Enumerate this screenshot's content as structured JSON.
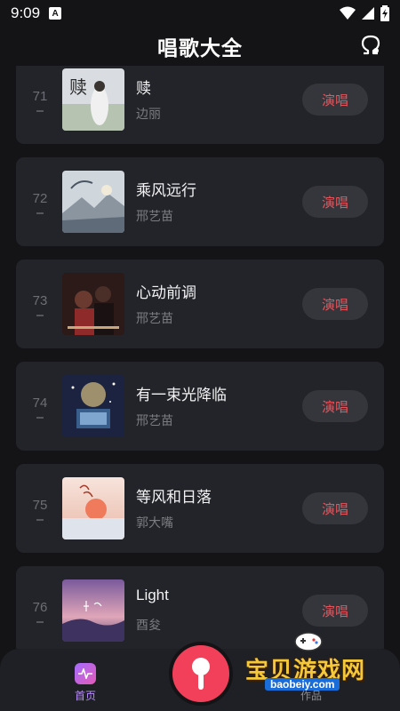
{
  "status_bar": {
    "time": "9:09",
    "badge": "A"
  },
  "header": {
    "title": "唱歌大全",
    "theme_icon": "omega-icon"
  },
  "songs": [
    {
      "rank": "71",
      "title": "赎",
      "artist": "边丽",
      "action": "演唱"
    },
    {
      "rank": "72",
      "title": "乘风远行",
      "artist": "邢艺苗",
      "action": "演唱"
    },
    {
      "rank": "73",
      "title": "心动前调",
      "artist": "邢艺苗",
      "action": "演唱"
    },
    {
      "rank": "74",
      "title": "有一束光降临",
      "artist": "邢艺苗",
      "action": "演唱"
    },
    {
      "rank": "75",
      "title": "等风和日落",
      "artist": "郭大嘴",
      "action": "演唱"
    },
    {
      "rank": "76",
      "title": "Light",
      "artist": "酉夋",
      "action": "演唱"
    }
  ],
  "bottom_nav": {
    "home_label": "首页",
    "works_label": "作品"
  },
  "watermark": {
    "text": "宝贝游戏网",
    "url": "baobeiy.com"
  },
  "colors": {
    "background": "#141417",
    "card": "#23242a",
    "accent_red": "#e8545a",
    "mic": "#f2405a",
    "home_active": "#b98cff"
  }
}
